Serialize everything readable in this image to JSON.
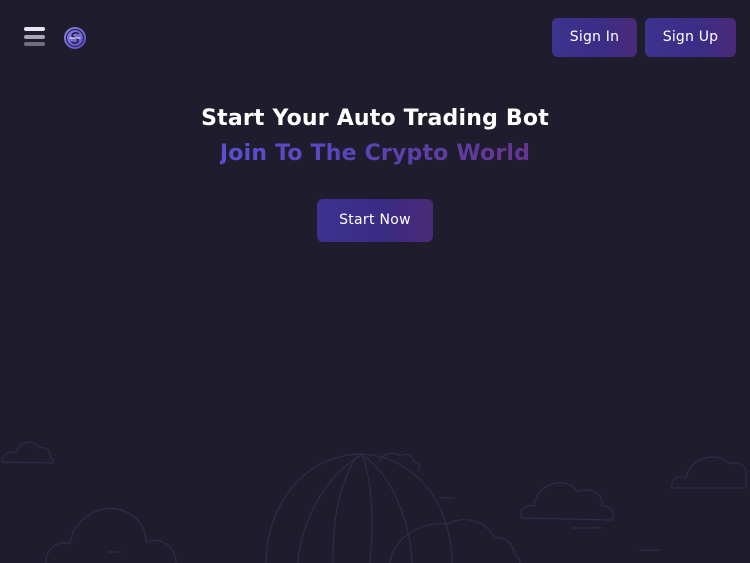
{
  "header": {
    "menu_icon": "hamburger-menu-icon",
    "logo_icon": "crypto-coin-logo-icon",
    "sign_in_label": "Sign In",
    "sign_up_label": "Sign Up"
  },
  "hero": {
    "title": "Start Your Auto Trading Bot",
    "subtitle": "Join To The Crypto World",
    "cta_label": "Start Now"
  },
  "colors": {
    "background": "#1f1d2d",
    "button_gradient_start": "#3d3490",
    "button_gradient_end": "#4a2a78",
    "subtitle_gradient_start": "#5b4fd0",
    "subtitle_gradient_end": "#64348f",
    "scenery_line": "#2e2b4a"
  },
  "decorations": {
    "background_art": "cloud-and-balloon-outline-illustration"
  }
}
